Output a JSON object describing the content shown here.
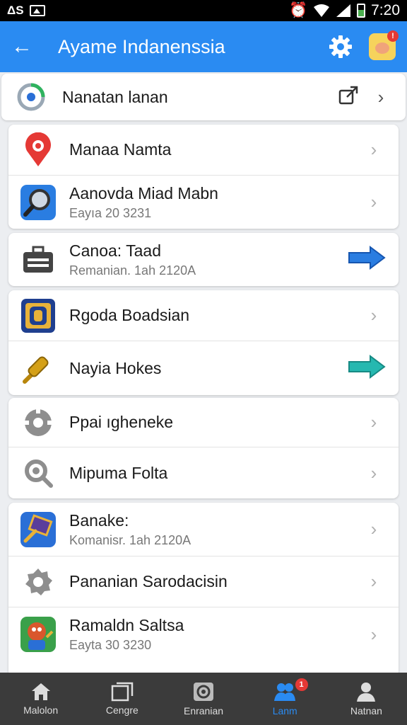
{
  "status_bar": {
    "left_text": "ΔS",
    "time": "7:20"
  },
  "app_bar": {
    "title": "Ayame Indanenssia",
    "badge": "!"
  },
  "items": [
    {
      "label": "Nanatan lanan",
      "sub": ""
    },
    {
      "label": "Manaa Namta",
      "sub": ""
    },
    {
      "label": "Aanovda Miad Mabn",
      "sub": "Eayıa 20 3231"
    },
    {
      "label": "Canoa: Taad",
      "sub": "Remanian. 1ah 2120A"
    },
    {
      "label": "Rgoda Boadsian",
      "sub": ""
    },
    {
      "label": "Nayia Hokes",
      "sub": ""
    },
    {
      "label": "Ppai ıgheneke",
      "sub": ""
    },
    {
      "label": "Mipuma Folta",
      "sub": ""
    },
    {
      "label": "Banake:",
      "sub": "Komanisr. 1ah 2120A"
    },
    {
      "label": "Pananian Sarodacisin",
      "sub": ""
    },
    {
      "label": "Ramaldn Saltsa",
      "sub": "Eayta 30 3230"
    }
  ],
  "bottom_nav": [
    {
      "label": "Malolon"
    },
    {
      "label": "Cengre"
    },
    {
      "label": "Enranian"
    },
    {
      "label": "Lanm",
      "badge": "1"
    },
    {
      "label": "Natnan"
    }
  ],
  "colors": {
    "primary": "#2a8bf2",
    "nav_bg": "#3b3b3b",
    "badge": "#e53935"
  }
}
